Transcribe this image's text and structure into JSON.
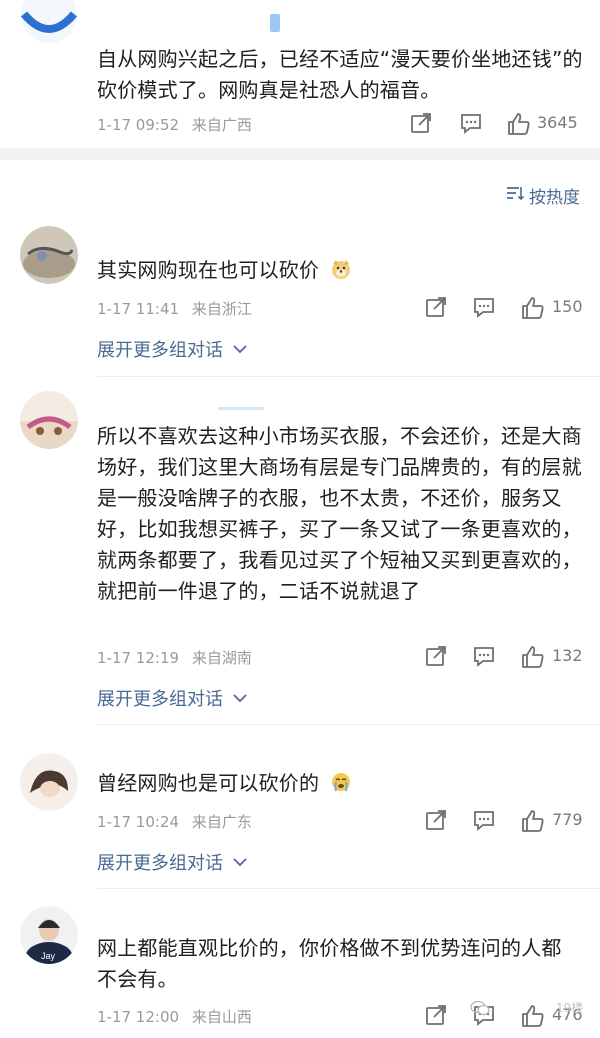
{
  "top_comment": {
    "text": "自从网购兴起之后，已经不适应“漫天要价坐地还钱”的砍价模式了。网购真是社恐人的福音。",
    "time": "1-17 09:52",
    "location": "来自广西",
    "likes": "3645"
  },
  "sort_label": "按热度",
  "comments": [
    {
      "text": "其实网购现在也可以砍价",
      "time": "1-17 11:41",
      "location": "来自浙江",
      "likes": "150",
      "expand": "展开更多组对话"
    },
    {
      "text": "所以不喜欢去这种小市场买衣服，不会还价，还是大商场好，我们这里大商场有层是专门品牌贵的，有的层就是一般没啥牌子的衣服，也不太贵，不还价，服务又好，比如我想买裤子，买了一条又试了一条更喜欢的，就两条都要了，我看见过买了个短袖又买到更喜欢的，就把前一件退了的，二话不说就退了",
      "time": "1-17 12:19",
      "location": "来自湖南",
      "likes": "132",
      "expand": "展开更多组对话"
    },
    {
      "text": "曾经网购也是可以砍价的",
      "time": "1-17 10:24",
      "location": "来自广东",
      "likes": "779",
      "expand": "展开更多组对话"
    },
    {
      "text": "网上都能直观比价的，你价格做不到优势连问的人都不会有。",
      "time": "1-17 12:00",
      "location": "来自山西",
      "likes": "476"
    }
  ],
  "avatar_texts": {
    "jay": "Jay"
  },
  "watermark": "19楼",
  "colors": {
    "link": "#4a6a93",
    "meta": "#9a9a9a",
    "icon": "#6f6f6f"
  }
}
